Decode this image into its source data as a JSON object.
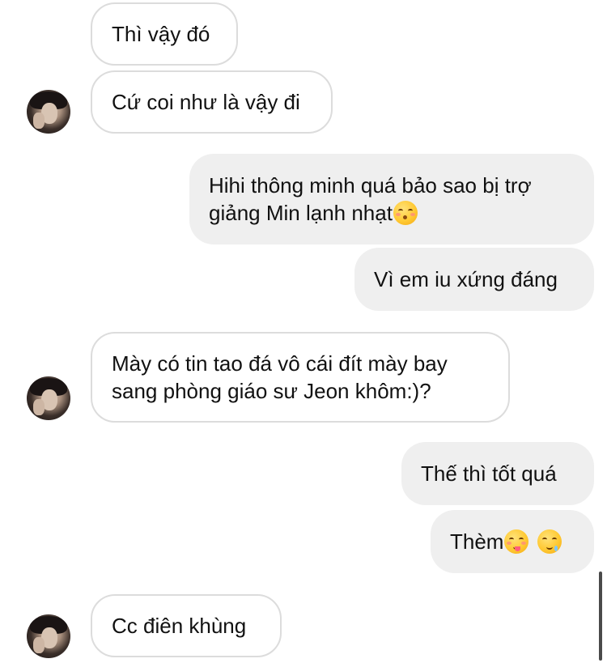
{
  "conversation": {
    "messages": [
      {
        "direction": "incoming",
        "text": "Thì vậy đó"
      },
      {
        "direction": "incoming",
        "text": "Cứ coi như là vậy đi"
      },
      {
        "direction": "outgoing",
        "text": "Hihi thông minh quá bảo sao bị trợ giảng Min lạnh nhạt",
        "emoji": "kissing-face-closed-eyes"
      },
      {
        "direction": "outgoing",
        "text": "Vì em iu xứng đáng"
      },
      {
        "direction": "incoming",
        "text": "Mày có tin tao đá vô cái đít mày bay sang phòng giáo sư Jeon khôm:)?"
      },
      {
        "direction": "outgoing",
        "text": "Thế thì tốt quá"
      },
      {
        "direction": "outgoing",
        "text": "Thèm",
        "emoji": [
          "face-savoring-food",
          "drooling-face"
        ]
      },
      {
        "direction": "incoming",
        "text": "Cc điên khùng"
      }
    ]
  },
  "colors": {
    "incoming_border": "#dcdcdc",
    "outgoing_background": "#efefef",
    "text": "#111111"
  }
}
